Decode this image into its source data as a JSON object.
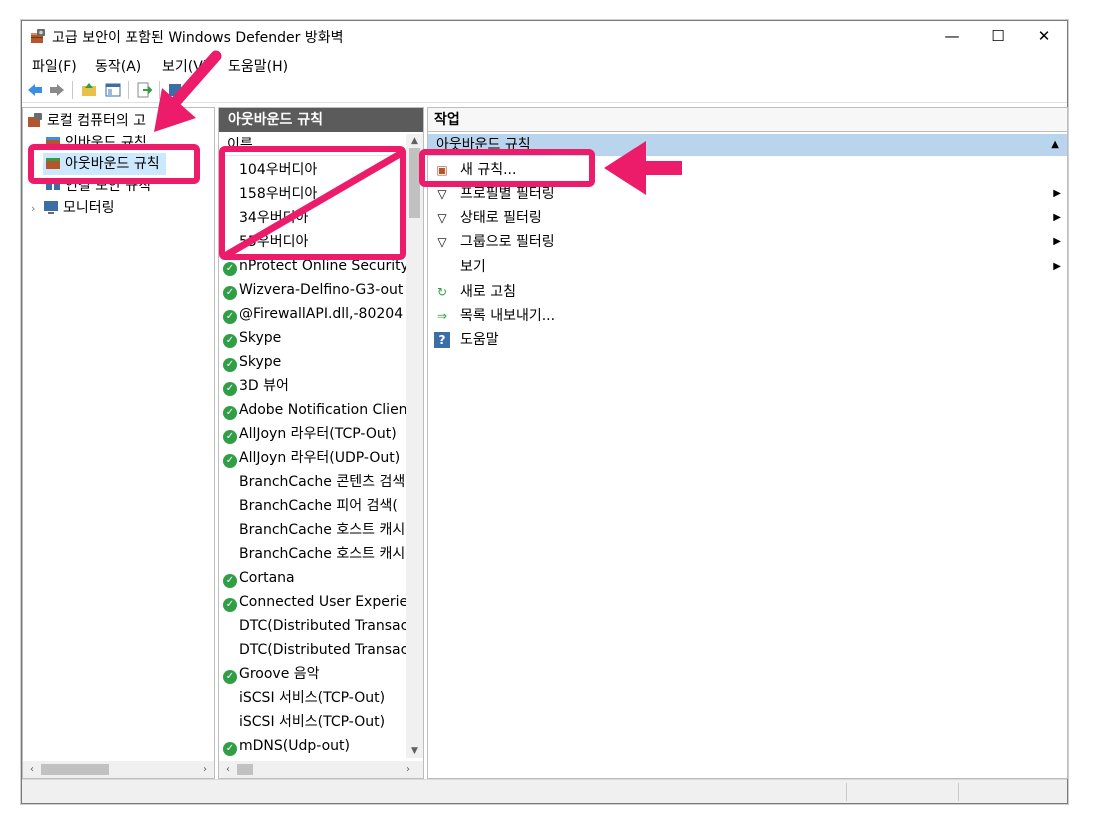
{
  "window": {
    "title": "고급 보안이 포함된 Windows Defender 방화벽",
    "minimize": "—",
    "maximize": "☐",
    "close": "✕"
  },
  "menu": [
    "파일(F)",
    "동작(A)",
    "보기(V)",
    "도움말(H)"
  ],
  "tree": {
    "root": "로컬 컴퓨터의 고",
    "inbound": "인바운드 규칙",
    "outbound": "아웃바운드 규칙",
    "connsec": "연결 보안 규칙",
    "monitor": "모니터링"
  },
  "list": {
    "header": "아웃바운드 규칙",
    "column": "이름",
    "rows": [
      {
        "name": "104우버디아",
        "check": false
      },
      {
        "name": "158우버디아",
        "check": false
      },
      {
        "name": "34우버디아",
        "check": false
      },
      {
        "name": "55우버디아",
        "check": false
      },
      {
        "name": "nProtect Online Security",
        "check": true
      },
      {
        "name": "Wizvera-Delfino-G3-out",
        "check": true
      },
      {
        "name": "@FirewallAPI.dll,-80204",
        "check": true
      },
      {
        "name": "Skype",
        "check": true
      },
      {
        "name": "Skype",
        "check": true
      },
      {
        "name": "3D 뷰어",
        "check": true
      },
      {
        "name": "Adobe Notification Client",
        "check": true
      },
      {
        "name": "AllJoyn 라우터(TCP-Out)",
        "check": true
      },
      {
        "name": "AllJoyn 라우터(UDP-Out)",
        "check": true
      },
      {
        "name": "BranchCache 콘텐츠 검색",
        "check": false
      },
      {
        "name": "BranchCache 피어 검색(",
        "check": false
      },
      {
        "name": "BranchCache 호스트 캐시",
        "check": false
      },
      {
        "name": "BranchCache 호스트 캐시",
        "check": false
      },
      {
        "name": "Cortana",
        "check": true
      },
      {
        "name": "Connected User Experience",
        "check": true
      },
      {
        "name": "DTC(Distributed Transaction",
        "check": false
      },
      {
        "name": "DTC(Distributed Transaction",
        "check": false
      },
      {
        "name": "Groove 음악",
        "check": true
      },
      {
        "name": "iSCSI 서비스(TCP-Out)",
        "check": false
      },
      {
        "name": "iSCSI 서비스(TCP-Out)",
        "check": false
      },
      {
        "name": "mDNS(Udp-out)",
        "check": true
      }
    ]
  },
  "actions": {
    "header": "작업",
    "group": "아웃바운드 규칙",
    "items": [
      {
        "label": "새 규칙...",
        "icon": "new-rule-icon",
        "glyph": "▣",
        "sub": ""
      },
      {
        "label": "프로필별 필터링",
        "icon": "filter-icon",
        "glyph": "▽",
        "sub": "▶"
      },
      {
        "label": "상태로 필터링",
        "icon": "filter-icon",
        "glyph": "▽",
        "sub": "▶"
      },
      {
        "label": "그룹으로 필터링",
        "icon": "filter-icon",
        "glyph": "▽",
        "sub": "▶"
      },
      {
        "label": "보기",
        "icon": "",
        "glyph": "",
        "sub": "▶"
      },
      {
        "label": "새로 고침",
        "icon": "refresh-icon",
        "glyph": "↻",
        "sub": ""
      },
      {
        "label": "목록 내보내기...",
        "icon": "export-icon",
        "glyph": "⇒",
        "sub": ""
      },
      {
        "label": "도움말",
        "icon": "help-icon",
        "glyph": "?",
        "sub": ""
      }
    ]
  },
  "colors": {
    "annotation": "#ec1c6b",
    "group_bg": "#b9d5ee",
    "list_header_bg": "#5b5b5b",
    "check_green": "#2f9e44"
  }
}
